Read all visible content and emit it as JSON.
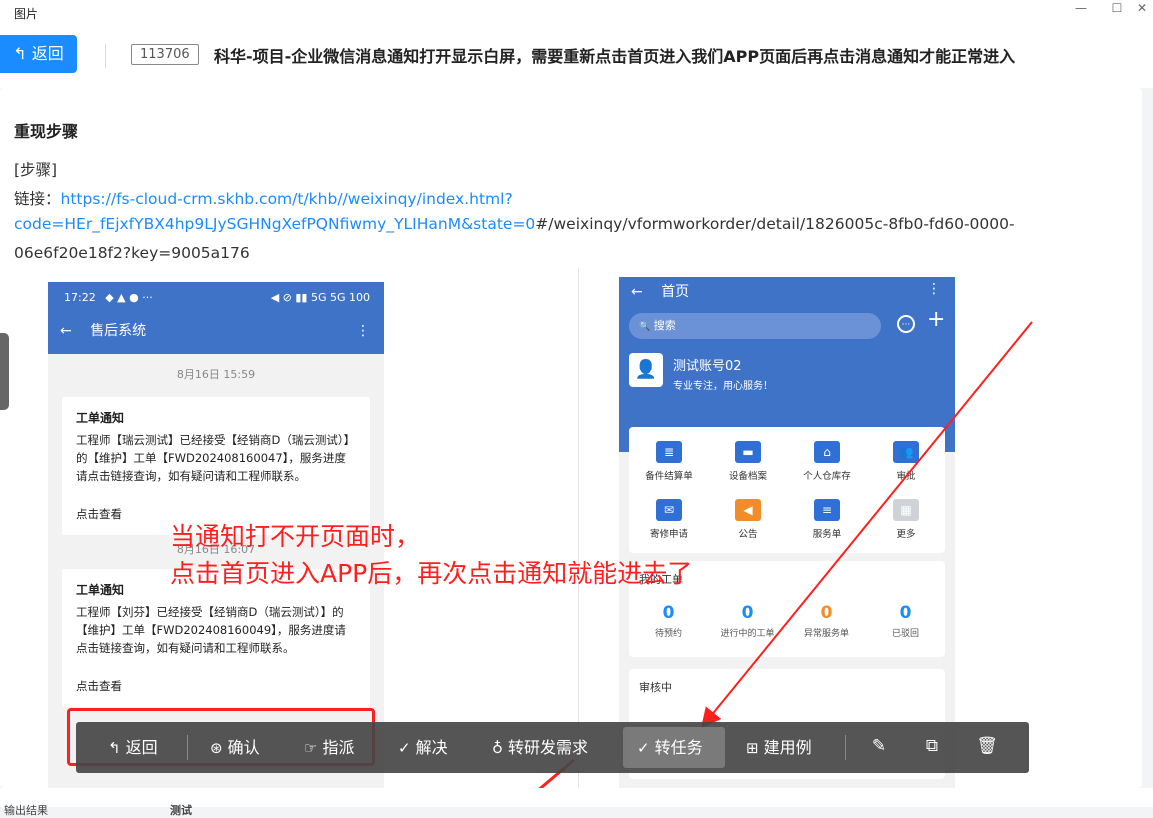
{
  "window": {
    "title": "图片",
    "minimize_icon": "—",
    "maximize_icon": "☐",
    "close_icon": "✕"
  },
  "header": {
    "back_label": "返回",
    "back_icon": "↰",
    "id_tag": "113706",
    "title": "科华-项目-企业微信消息通知打开显示白屏，需要重新点击首页进入我们APP页面后再点击消息通知才能正常进入"
  },
  "content": {
    "section_title": "重现步骤",
    "steps_label": "[步骤]",
    "link_prefix": "链接：",
    "link_part1": "https://fs-cloud-crm.skhb.com/t/khb//weixinqy/index.html?",
    "link_part2": "code=HEr_fEjxfYBX4hp9LJySGHNgXefPQNfiwmy_YLIHanM&state=0",
    "link_rest": "#/weixinqy/vformworkorder/detail/1826005c-8fb0-fd60-0000-",
    "link_line3": "06e6f20e18f2?key=9005a176"
  },
  "phone_left": {
    "status_time": "17:22",
    "status_icons": "◆ ▲ ● ···",
    "status_right": "◀ ⊘ ▮▮ 5G 5G 100",
    "nav_back_icon": "←",
    "nav_title": "售后系统",
    "nav_dots": "⋮",
    "timestamp": "8月16日  15:59",
    "notices": [
      {
        "title": "工单通知",
        "body": "工程师【瑞云测试】已经接受【经销商D（瑞云测试）】的【维护】工单【FWD202408160047】，服务进度请点击链接查询，如有疑问请和工程师联系。",
        "view": "点击查看"
      },
      {
        "title": "工单通知",
        "body": "工程师【刘芬】已经接受【经销商D（瑞云测试）】的【维护】工单【FWD202408160049】，服务进度请点击链接查询，如有疑问请和工程师联系。",
        "view": "点击查看"
      }
    ],
    "timestamp2": "8月16日  16:07"
  },
  "phone_right": {
    "nav_back_icon": "←",
    "nav_title": "首页",
    "nav_dots": "⋮",
    "search_placeholder": "搜索",
    "search_icon": "🔍",
    "chat_icon": "···",
    "add_icon": "+",
    "account_name": "测试账号02",
    "slogan": "专业专注，用心服务！",
    "avatar_icon": "👤",
    "grid": [
      {
        "label": "备件结算单",
        "glyph": "≣",
        "color": "#2f6fd6"
      },
      {
        "label": "设备档案",
        "glyph": "▬",
        "color": "#2f6fd6"
      },
      {
        "label": "个人仓库存",
        "glyph": "⌂",
        "color": "#2f6fd6"
      },
      {
        "label": "审批",
        "glyph": "👥",
        "color": "#2f6fd6"
      },
      {
        "label": "寄修申请",
        "glyph": "✉",
        "color": "#2f6fd6"
      },
      {
        "label": "公告",
        "glyph": "◀",
        "color": "#f28c28"
      },
      {
        "label": "服务单",
        "glyph": "≡",
        "color": "#2f6fd6"
      },
      {
        "label": "更多",
        "glyph": "▦",
        "color": "#cfd3d8"
      }
    ],
    "orders_title": "我的工单",
    "orders": [
      {
        "value": "0",
        "label": "待预约",
        "color": "#1a8cff"
      },
      {
        "value": "0",
        "label": "进行中的工单",
        "color": "#1a8cff"
      },
      {
        "value": "0",
        "label": "异常服务单",
        "color": "#f28c28"
      },
      {
        "value": "0",
        "label": "已驳回",
        "color": "#1a8cff"
      }
    ],
    "review_title": "审核中"
  },
  "annotation": {
    "line1": "当通知打不开页面时，",
    "line2": "点击首页进入APP后，再次点击通知就能进去了",
    "color": "#ff1f1f"
  },
  "toolbar": {
    "items": [
      {
        "icon": "↰",
        "label": "返回"
      },
      {
        "icon": "⊛",
        "label": "确认"
      },
      {
        "icon": "☞",
        "label": "指派"
      },
      {
        "icon": "✓",
        "label": "解决"
      },
      {
        "icon": "♁",
        "label": "转研发需求"
      },
      {
        "icon": "✓",
        "label": "转任务"
      },
      {
        "icon": "⊞",
        "label": "建用例"
      }
    ],
    "edit_icon": "✎",
    "copy_icon": "⧉",
    "delete_icon": "🗑"
  },
  "footer": {
    "left_text": "输出结果",
    "mid_text": "测试"
  },
  "colors": {
    "accent": "#1a8cff",
    "app_blue": "#3f73c8",
    "annotation_red": "#ff1f1f",
    "toolbar_bg": "#464646"
  }
}
